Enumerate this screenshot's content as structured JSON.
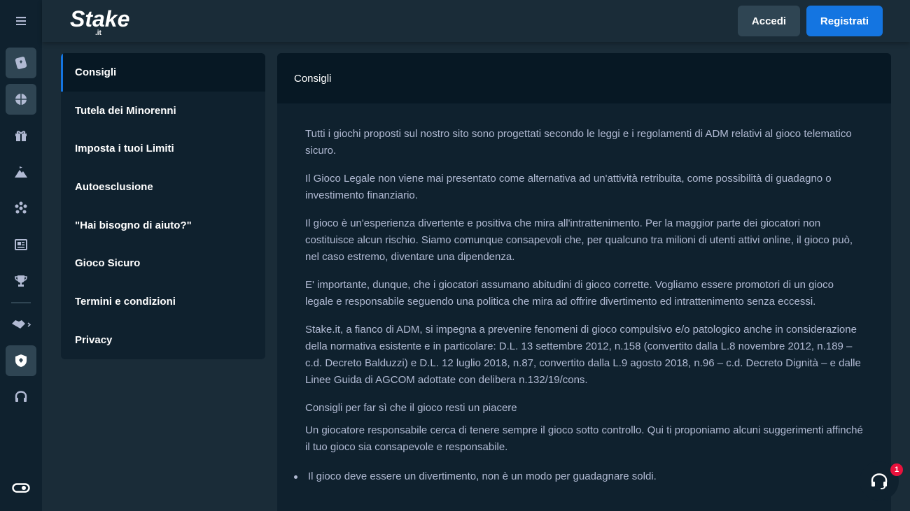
{
  "header": {
    "logo_text": "Stake",
    "logo_suffix": ".it",
    "login_label": "Accedi",
    "register_label": "Registrati"
  },
  "rail": {
    "icons": [
      "menu-icon",
      "casino-icon",
      "sports-icon",
      "gift-icon",
      "mountain-icon",
      "asterisk-icon",
      "news-icon",
      "trophy-icon",
      "handshake-icon",
      "shield-icon",
      "headset-icon",
      "vip-icon"
    ]
  },
  "sidemenu": {
    "items": [
      {
        "label": "Consigli"
      },
      {
        "label": "Tutela dei Minorenni"
      },
      {
        "label": "Imposta i tuoi Limiti"
      },
      {
        "label": "Autoesclusione"
      },
      {
        "label": "\"Hai bisogno di aiuto?\""
      },
      {
        "label": "Gioco Sicuro"
      },
      {
        "label": "Termini e condizioni"
      },
      {
        "label": "Privacy"
      }
    ]
  },
  "content": {
    "title": "Consigli",
    "paragraphs": [
      "Tutti i giochi proposti sul nostro sito sono progettati secondo le leggi e i regolamenti di ADM relativi al gioco telematico sicuro.",
      "Il Gioco Legale non viene mai presentato come alternativa ad un'attività retribuita, come possibilità di guadagno o investimento finanziario.",
      "Il gioco è un'esperienza divertente e positiva che mira all'intrattenimento. Per la maggior parte dei giocatori non costituisce alcun rischio. Siamo comunque consapevoli che, per qualcuno tra milioni di utenti attivi online, il gioco può, nel caso estremo, diventare una dipendenza.",
      "E' importante, dunque, che i giocatori assumano abitudini di gioco corrette. Vogliamo essere promotori di un gioco legale e responsabile seguendo una politica che mira ad offrire divertimento ed intrattenimento senza eccessi.",
      "Stake.it, a fianco di ADM, si impegna a prevenire fenomeni di gioco compulsivo e/o patologico anche in considerazione della normativa esistente e in particolare: D.L. 13 settembre 2012, n.158 (convertito dalla L.8 novembre 2012, n.189 – c.d. Decreto Balduzzi) e D.L. 12 luglio 2018, n.87, convertito dalla L.9 agosto 2018, n.96 – c.d. Decreto Dignità – e dalle Linee Guida di AGCOM adottate con delibera n.132/19/cons.",
      "Consigli per far sì che il gioco resti un piacere",
      "Un giocatore responsabile cerca di tenere sempre il gioco sotto controllo. Qui ti proponiamo alcuni suggerimenti affinché il tuo gioco sia consapevole e responsabile."
    ],
    "bullets": [
      "Il gioco deve essere un divertimento, non è un modo per guadagnare soldi."
    ]
  },
  "chat": {
    "badge_count": "1"
  }
}
